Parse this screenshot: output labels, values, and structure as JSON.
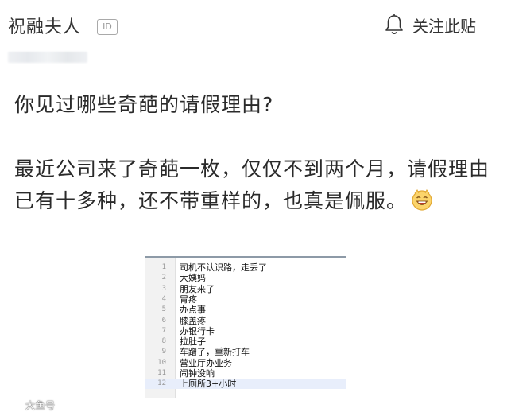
{
  "header": {
    "author": "祝融夫人",
    "id_badge": "ID",
    "follow_label": "关注此贴"
  },
  "post": {
    "question": "你见过哪些奇葩的请假理由?",
    "body": "最近公司来了奇葩一枚，仅仅不到两个月，请假理由已有十多种，还不带重样的，也真是佩服。"
  },
  "embedded_list": [
    {
      "n": "1",
      "text": "司机不认识路，走丢了"
    },
    {
      "n": "2",
      "text": "大姨妈"
    },
    {
      "n": "3",
      "text": "朋友来了"
    },
    {
      "n": "4",
      "text": "胃疼"
    },
    {
      "n": "5",
      "text": "办点事"
    },
    {
      "n": "6",
      "text": "膝盖疼"
    },
    {
      "n": "7",
      "text": "办银行卡"
    },
    {
      "n": "8",
      "text": "拉肚子"
    },
    {
      "n": "9",
      "text": "车蹭了，重新打车"
    },
    {
      "n": "10",
      "text": "营业厅办业务"
    },
    {
      "n": "11",
      "text": "闹钟没响"
    },
    {
      "n": "12",
      "text": "上厕所3+小时"
    }
  ],
  "watermark": "大鱼号"
}
